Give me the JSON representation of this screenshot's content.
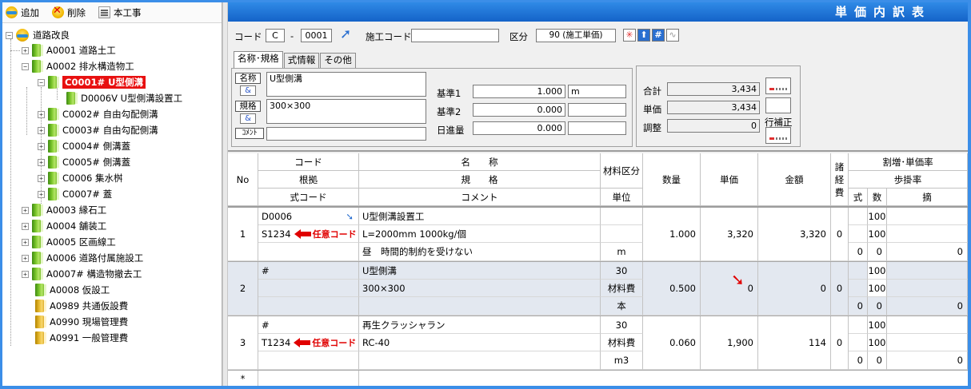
{
  "toolbar": {
    "add": "追加",
    "delete": "削除",
    "project": "本工事"
  },
  "tree": {
    "root": "道路改良",
    "items": [
      {
        "code": "A0001",
        "name": "道路土工"
      },
      {
        "code": "A0002",
        "name": "排水構造物工"
      },
      {
        "code": "C0001#",
        "name": "U型側溝",
        "selected": true
      },
      {
        "code": "D0006V",
        "name": "U型側溝設置工"
      },
      {
        "code": "C0002#",
        "name": "自由勾配側溝"
      },
      {
        "code": "C0003#",
        "name": "自由勾配側溝"
      },
      {
        "code": "C0004#",
        "name": "側溝蓋"
      },
      {
        "code": "C0005#",
        "name": "側溝蓋"
      },
      {
        "code": "C0006",
        "name": "集水桝"
      },
      {
        "code": "C0007#",
        "name": "蓋"
      },
      {
        "code": "A0003",
        "name": "縁石工"
      },
      {
        "code": "A0004",
        "name": "舗装工"
      },
      {
        "code": "A0005",
        "name": "区画線工"
      },
      {
        "code": "A0006",
        "name": "道路付属施設工"
      },
      {
        "code": "A0007#",
        "name": "構造物撤去工"
      },
      {
        "code": "A0008",
        "name": "仮設工"
      },
      {
        "code": "A0989",
        "name": "共通仮設費"
      },
      {
        "code": "A0990",
        "name": "現場管理費"
      },
      {
        "code": "A0991",
        "name": "一般管理費"
      }
    ]
  },
  "window": {
    "title": "単価内訳表"
  },
  "header": {
    "code_label": "コード",
    "code_prefix": "C",
    "code_dash": "-",
    "code_value": "0001",
    "work_code_label": "施工コード",
    "work_code_value": "",
    "kubun_label": "区分",
    "kubun_value": "90 (施工単価)",
    "btn_star": "✳",
    "btn_up": "⬆",
    "btn_hash": "#",
    "btn_wave": "∿",
    "tabs": [
      "名称･規格",
      "式情報",
      "その他"
    ],
    "name_label": "名称",
    "name_value": "U型側溝",
    "amp": "&",
    "spec_label": "規格",
    "spec_value": "300×300",
    "comment_label": "ｺﾒﾝﾄ",
    "comment_value": "",
    "kijun1_label": "基準1",
    "kijun1_value": "1.000",
    "kijun1_unit": "m",
    "kijun2_label": "基準2",
    "kijun2_value": "0.000",
    "kijun2_unit": "",
    "nissin_label": "日進量",
    "nissin_value": "0.000",
    "nissin_unit": "",
    "total_label": "合計",
    "total_value": "3,434",
    "unit_label": "単価",
    "unit_value": "3,434",
    "adjust_label": "調整",
    "adjust_value": "0",
    "row_correct": "行補正"
  },
  "grid": {
    "headers": {
      "no": "No",
      "code": "コード",
      "basis": "根拠",
      "formula_code": "式コード",
      "name": "名　　称",
      "spec": "規　　格",
      "comment": "コメント",
      "material": "材料区分",
      "unit": "単位",
      "qty": "数量",
      "price": "単価",
      "amount": "金額",
      "misc": "諸経費",
      "markup": "割増･単価率",
      "step": "歩掛率",
      "shiki": "式",
      "count": "数",
      "note": "摘"
    },
    "rows": [
      {
        "no": "1",
        "code": "D0006",
        "basis": "S1234",
        "formula": "",
        "tag": "任意コード",
        "name": "U型側溝設置工",
        "spec": "L=2000mm 1000kg/個",
        "comment": "昼　時間的制約を受けない",
        "material": "",
        "mat2": "",
        "unit": "m",
        "qty": "1.000",
        "price": "3,320",
        "amount": "3,320",
        "misc": "0",
        "r1": "100",
        "r2": "100",
        "s": "0",
        "c": "0",
        "n": "0"
      },
      {
        "no": "2",
        "code": "#",
        "basis": "",
        "formula": "",
        "tag": "",
        "name": "U型側溝",
        "spec": "300×300",
        "comment": "",
        "material": "30",
        "mat2": "材料費",
        "unit": "本",
        "qty": "0.500",
        "price": "0",
        "amount": "0",
        "misc": "0",
        "r1": "100",
        "r2": "100",
        "s": "0",
        "c": "0",
        "n": "0"
      },
      {
        "no": "3",
        "code": "#",
        "basis": "T1234",
        "formula": "",
        "tag": "任意コード",
        "name": "再生クラッシャラン",
        "spec": "RC-40",
        "comment": "",
        "material": "30",
        "mat2": "材料費",
        "unit": "m3",
        "qty": "0.060",
        "price": "1,900",
        "amount": "114",
        "misc": "0",
        "r1": "100",
        "r2": "100",
        "s": "0",
        "c": "0",
        "n": "0"
      }
    ],
    "new_row_marker": "*"
  },
  "colors": {
    "titlebar": "#1e74dc",
    "frame": "#3b8ee8",
    "selected": "#e81010",
    "tag": "#e00000",
    "row2": "#e3e8f0"
  }
}
